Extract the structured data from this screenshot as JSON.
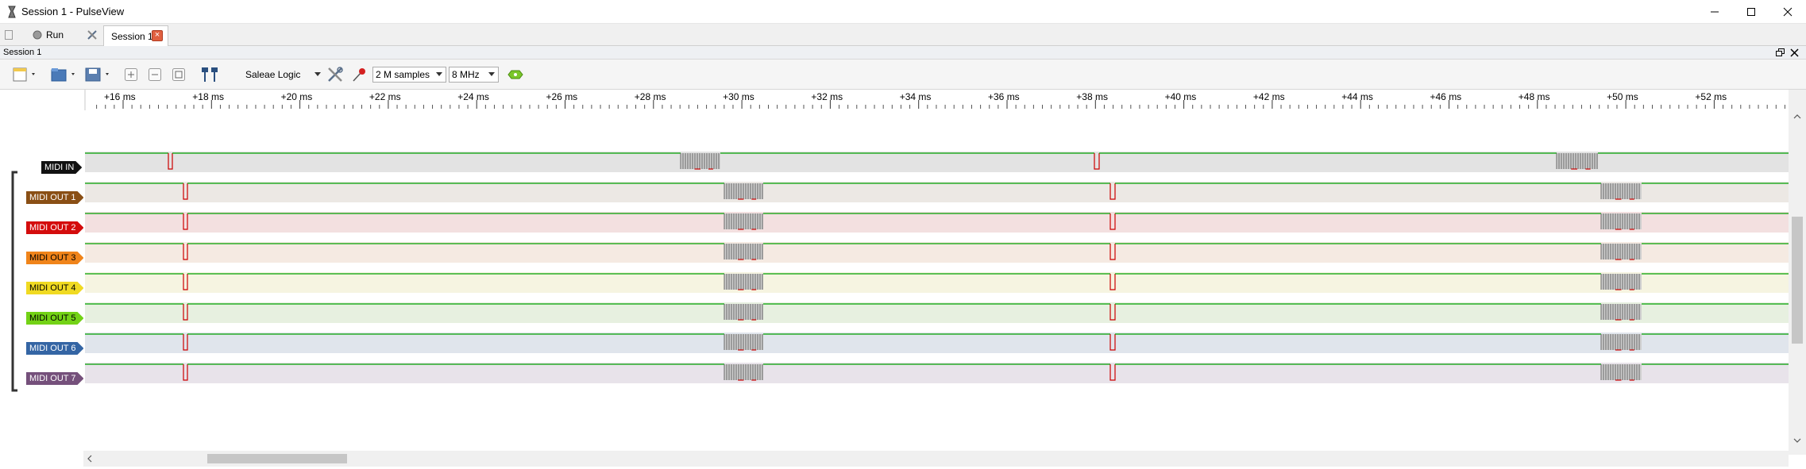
{
  "window": {
    "title": "Session 1 - PulseView"
  },
  "tabbar": {
    "run_label": "Run",
    "session_tab_label": "Session 1"
  },
  "dock": {
    "title": "Session 1"
  },
  "toolbar": {
    "device_label": "Saleae Logic",
    "samples_value": "2 M samples",
    "rate_value": "8 MHz"
  },
  "ruler": {
    "labels": [
      "+16 ms",
      "+18 ms",
      "+20 ms",
      "+22 ms",
      "+24 ms",
      "+26 ms",
      "+28 ms",
      "+30 ms",
      "+32 ms",
      "+34 ms",
      "+36 ms",
      "+38 ms",
      "+40 ms",
      "+42 ms",
      "+44 ms",
      "+46 ms",
      "+48 ms",
      "+50 ms",
      "+52 ms"
    ]
  },
  "channels": [
    {
      "name": "MIDI IN",
      "color": "#111111",
      "text_color": "#ffffff",
      "bg": "#e3e3e3"
    },
    {
      "name": "MIDI OUT 1",
      "color": "#8a4f15",
      "text_color": "#ffffff",
      "bg": "#ece8e4"
    },
    {
      "name": "MIDI OUT 2",
      "color": "#d40c0c",
      "text_color": "#ffffff",
      "bg": "#f3e0e0"
    },
    {
      "name": "MIDI OUT 3",
      "color": "#f0841a",
      "text_color": "#000000",
      "bg": "#f5eae2"
    },
    {
      "name": "MIDI OUT 4",
      "color": "#f0da22",
      "text_color": "#000000",
      "bg": "#f6f4e1"
    },
    {
      "name": "MIDI OUT 5",
      "color": "#73d216",
      "text_color": "#000000",
      "bg": "#e7f0e0"
    },
    {
      "name": "MIDI OUT 6",
      "color": "#3465a4",
      "text_color": "#ffffff",
      "bg": "#e0e5ec"
    },
    {
      "name": "MIDI OUT 7",
      "color": "#75507b",
      "text_color": "#ffffff",
      "bg": "#e8e3ea"
    }
  ],
  "colors": {
    "signal_high": "#00a000",
    "signal_low": "#cc0000",
    "dense": "#666666"
  }
}
